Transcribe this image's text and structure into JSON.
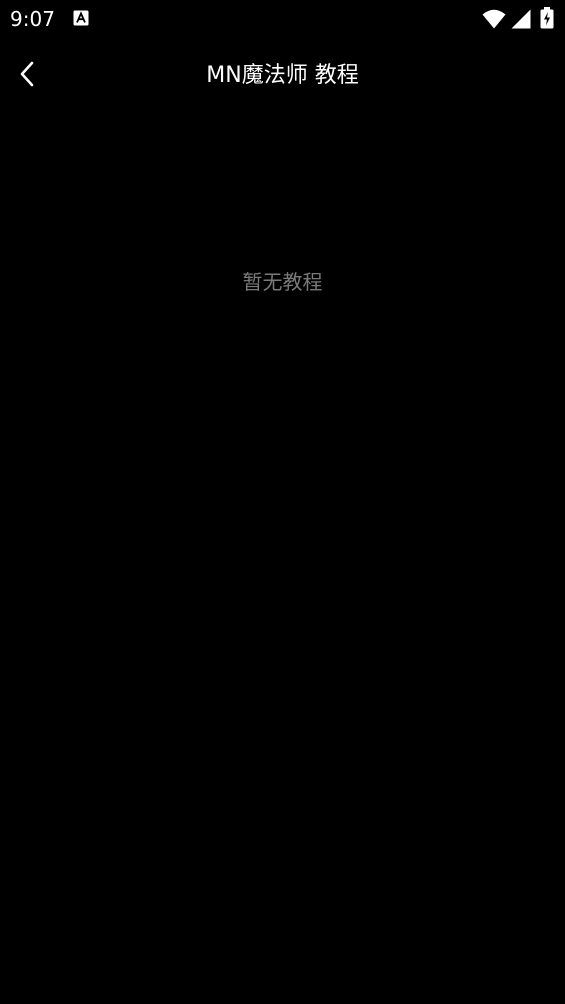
{
  "status_bar": {
    "time": "9:07",
    "notification_icon": "text-a-icon",
    "wifi_icon": "wifi-icon",
    "signal_icon": "cell-signal-icon",
    "battery_icon": "battery-charging-icon"
  },
  "header": {
    "back_icon": "chevron-left-icon",
    "title": "MN魔法师 教程"
  },
  "content": {
    "empty_message": "暂无教程"
  },
  "colors": {
    "background": "#000000",
    "text_primary": "#ffffff",
    "text_muted": "#7a7a7a"
  }
}
